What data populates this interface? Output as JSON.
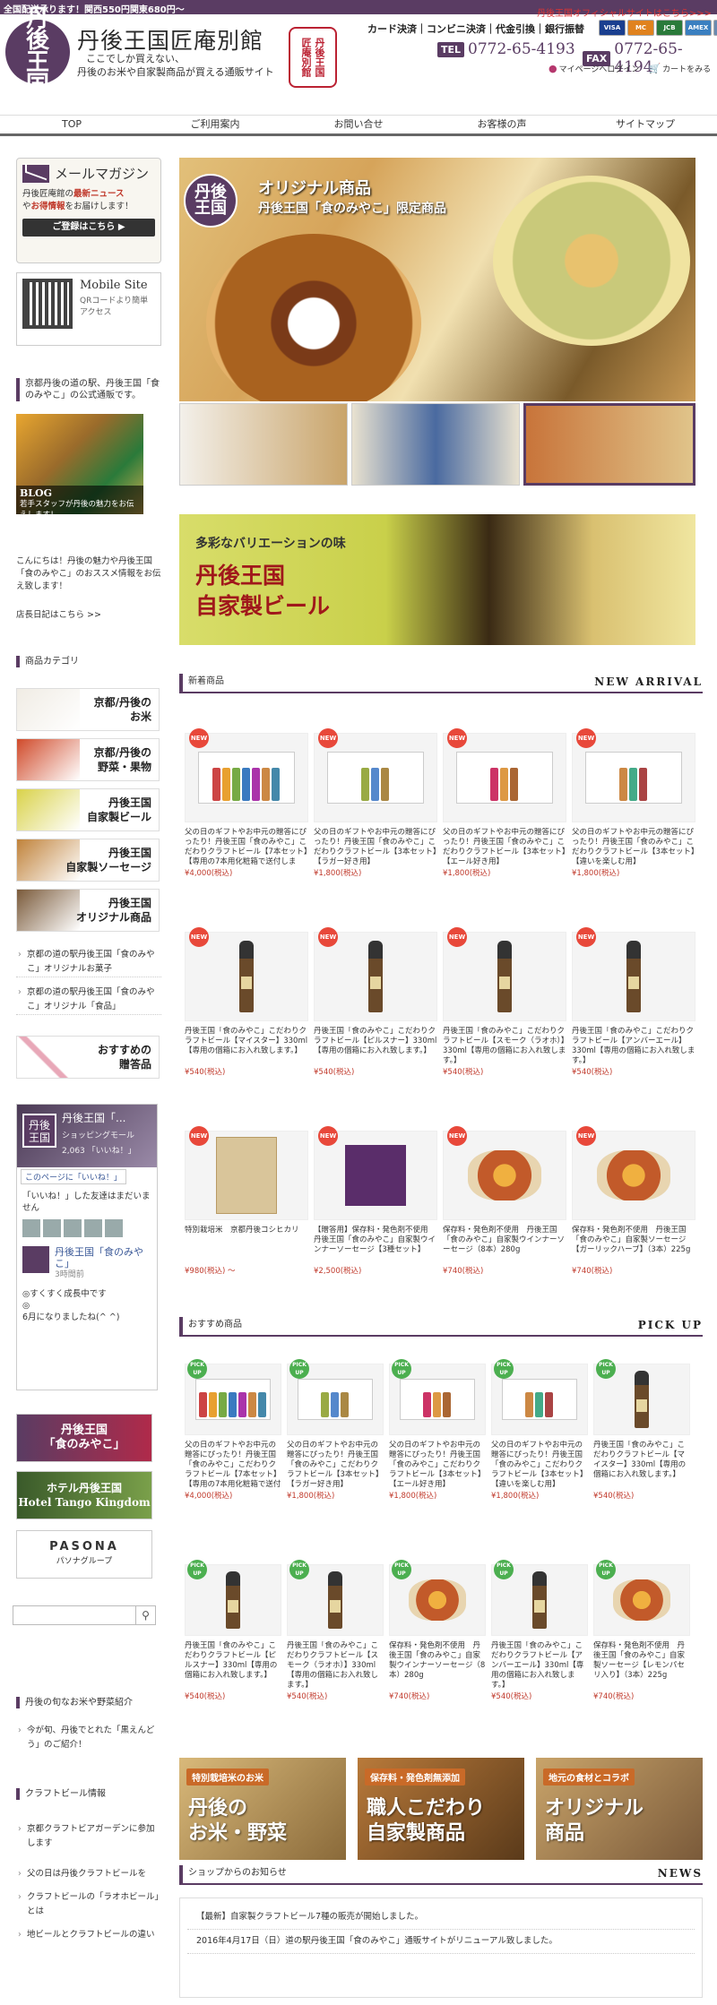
{
  "topbar": {
    "text": "全国配送承ります！関西550円関東680円〜"
  },
  "header": {
    "logo_text": "丹後王国",
    "site_name": "丹後王国匠庵別館",
    "tagline_1": "ここでしか買えない、",
    "tagline_2": "丹後のお米や自家製商品が買える通販サイト",
    "seal_col_1": "匠庵別館",
    "seal_col_2": "丹後王国",
    "official_link": "丹後王国オフィシャルサイトはこちら>>>",
    "payment_methods": "カード決済｜コンビニ決済｜代金引換｜銀行振替",
    "cards": [
      {
        "label": "VISA",
        "color": "#1a3f8f"
      },
      {
        "label": "MC",
        "color": "#e0821e"
      },
      {
        "label": "JCB",
        "color": "#2a7a3a"
      },
      {
        "label": "AMEX",
        "color": "#3a7fc0"
      },
      {
        "label": "DC",
        "color": "#6a8ab0"
      }
    ],
    "tel_label": "TEL",
    "tel_number": "0772-65-4193",
    "fax_label": "FAX",
    "fax_number": "0772-65-4194",
    "mypage": "マイページへログイン",
    "cart": "カートをみる"
  },
  "nav": [
    "TOP",
    "ご利用案内",
    "お問い合せ",
    "お客様の声",
    "サイトマップ"
  ],
  "sidebar": {
    "mail_title": "メールマガジン",
    "mail_desc_1": "丹後匠庵館の",
    "mail_desc_hl1": "最新ニュース",
    "mail_desc_2": "や",
    "mail_desc_hl2": "お得情報",
    "mail_desc_3": "をお届けします！",
    "mail_button": "ご登録はこちら ▶",
    "mobile_title": "Mobile Site",
    "mobile_desc": "QRコードより簡単アクセス",
    "blog_heading": "京都丹後の道の駅、丹後王国「食のみやこ」の公式通販です。",
    "blog_caption_title": "BLOG",
    "blog_caption": "若手スタッフが丹後の魅力をお伝えします！",
    "intro": "こんにちは！丹後の魅力や丹後王国「食のみやこ」のおススメ情報をお伝え致します！",
    "manager_link": "店長日記はこちら >>",
    "category_heading": "商品カテゴリ",
    "categories": [
      {
        "label": "京都/丹後の\nお米"
      },
      {
        "label": "京都/丹後の\n野菜・果物"
      },
      {
        "label": "丹後王国\n自家製ビール"
      },
      {
        "label": "丹後王国\n自家製ソーセージ"
      },
      {
        "label": "丹後王国\nオリジナル商品"
      }
    ],
    "cat_links": [
      "京都の道の駅丹後王国「食のみやこ」オリジナルお菓子",
      "京都の道の駅丹後王国「食のみやこ」オリジナル「食品」"
    ],
    "gift": "おすすめの\n贈答品",
    "fb_name": "丹後王国「...",
    "fb_sub": "ショッピングモール",
    "fb_likes": "2,063 「いいね！」",
    "fb_like_button": "このページに「いいね！」",
    "fb_friends": "「いいね！」した友達はまだいません",
    "fb_post_name": "丹後王国「食のみやこ」",
    "fb_post_time": "3時間前",
    "fb_post_1": "◎すくすく成長中です",
    "fb_post_2": "◎",
    "fb_post_3": "6月になりましたね(^ ^)",
    "banner_1": "丹後王国\n「食のみやこ」",
    "banner_2": "ホテル丹後王国\nHotel Tango Kingdom",
    "banner_3_main": "PASONA",
    "banner_3_sub": "パソナグループ",
    "info_heading": "丹後の旬なお米や野菜紹介",
    "info_link": "今が旬、丹後でとれた「黒えんどう」のご紹介！",
    "craft_heading": "クラフトビール情報",
    "craft_links": [
      "京都クラフトビアガーデンに参加します",
      "父の日は丹後クラフトビールを",
      "クラフトビールの「ラオホビール」とは",
      "地ビールとクラフトビールの違い"
    ]
  },
  "hero": {
    "badge": "丹後\n王国",
    "title_1": "オリジナル商品",
    "title_2": "丹後王国「食のみやこ」限定商品"
  },
  "beer_banner": {
    "line_1": "多彩なバリエーションの味",
    "line_2": "丹後王国",
    "line_3": "自家製ビール"
  },
  "new_arrival": {
    "heading": "新着商品",
    "heading_en": "NEW ARRIVAL",
    "badge": "NEW",
    "items": [
      {
        "name": "父の日のギフトやお中元の贈答にぴったり！丹後王国「食のみやこ」こだわりクラフトビール【7本セット】【専用の7本用化粧箱で送付します。】",
        "price": "¥4,000(税込)",
        "kind": "box7"
      },
      {
        "name": "父の日のギフトやお中元の贈答にぴったり！丹後王国「食のみやこ」こだわりクラフトビール【3本セット】【ラガー好き用】",
        "price": "¥1,800(税込)",
        "kind": "box3a"
      },
      {
        "name": "父の日のギフトやお中元の贈答にぴったり！丹後王国「食のみやこ」こだわりクラフトビール【3本セット】【エール好き用】",
        "price": "¥1,800(税込)",
        "kind": "box3b"
      },
      {
        "name": "父の日のギフトやお中元の贈答にぴったり！丹後王国「食のみやこ」こだわりクラフトビール【3本セット】【違いを楽しむ用】",
        "price": "¥1,800(税込)",
        "kind": "box3c"
      },
      {
        "name": "丹後王国「食のみやこ」こだわりクラフトビール【マイスター】330ml【専用の個箱にお入れ致します。】",
        "price": "¥540(税込)",
        "kind": "bottle"
      },
      {
        "name": "丹後王国「食のみやこ」こだわりクラフトビール【ピルスナー】330ml【専用の個箱にお入れ致します。】",
        "price": "¥540(税込)",
        "kind": "bottle"
      },
      {
        "name": "丹後王国「食のみやこ」こだわりクラフトビール【スモーク（ラオホ）】330ml【専用の個箱にお入れ致します。】",
        "price": "¥540(税込)",
        "kind": "bottle"
      },
      {
        "name": "丹後王国「食のみやこ」こだわりクラフトビール【アンバーエール】330ml【専用の個箱にお入れ致します。】",
        "price": "¥540(税込)",
        "kind": "bottle"
      },
      {
        "name": "特別栽培米　京都丹後コシヒカリ",
        "price": "¥980(税込) 〜",
        "kind": "bag"
      },
      {
        "name": "【贈答用】保存料・発色剤不使用　丹後王国「食のみやこ」自家製ウインナーソーセージ【3種セット】",
        "price": "¥2,500(税込)",
        "kind": "book"
      },
      {
        "name": "保存料・発色剤不使用　丹後王国「食のみやこ」自家製ウインナーソーセージ（8本）280g",
        "price": "¥740(税込)",
        "kind": "saus"
      },
      {
        "name": "保存料・発色剤不使用　丹後王国「食のみやこ」自家製ソーセージ【ガーリックハーブ】（3本）225g",
        "price": "¥740(税込)",
        "kind": "saus"
      }
    ]
  },
  "pick_up": {
    "heading": "おすすめ商品",
    "heading_en": "PICK UP",
    "badge": "PICK UP",
    "items": [
      {
        "name": "父の日のギフトやお中元の贈答にぴったり！丹後王国「食のみやこ」こだわりクラフトビール【7本セット】【専用の7本用化粧箱で送付します。】",
        "price": "¥4,000(税込)",
        "kind": "box7"
      },
      {
        "name": "父の日のギフトやお中元の贈答にぴったり！丹後王国「食のみやこ」こだわりクラフトビール【3本セット】【ラガー好き用】",
        "price": "¥1,800(税込)",
        "kind": "box3a"
      },
      {
        "name": "父の日のギフトやお中元の贈答にぴったり！丹後王国「食のみやこ」こだわりクラフトビール【3本セット】【エール好き用】",
        "price": "¥1,800(税込)",
        "kind": "box3b"
      },
      {
        "name": "父の日のギフトやお中元の贈答にぴったり！丹後王国「食のみやこ」こだわりクラフトビール【3本セット】【違いを楽しむ用】",
        "price": "¥1,800(税込)",
        "kind": "box3c"
      },
      {
        "name": "丹後王国「食のみやこ」こだわりクラフトビール【マイスター】330ml【専用の個箱にお入れ致します。】",
        "price": "¥540(税込)",
        "kind": "bottle"
      },
      {
        "name": "丹後王国「食のみやこ」こだわりクラフトビール【ピルスナー】330ml【専用の個箱にお入れ致します。】",
        "price": "¥540(税込)",
        "kind": "bottle"
      },
      {
        "name": "丹後王国「食のみやこ」こだわりクラフトビール【スモーク（ラオホ）】330ml【専用の個箱にお入れ致します。】",
        "price": "¥540(税込)",
        "kind": "bottle"
      },
      {
        "name": "保存料・発色剤不使用　丹後王国「食のみやこ」自家製ウインナーソーセージ（8本）280g",
        "price": "¥740(税込)",
        "kind": "saus"
      },
      {
        "name": "丹後王国「食のみやこ」こだわりクラフトビール【アンバーエール】330ml【専用の個箱にお入れ致します。】",
        "price": "¥540(税込)",
        "kind": "bottle"
      },
      {
        "name": "保存料・発色剤不使用　丹後王国「食のみやこ」自家製ソーセージ【レモンパセリ入り】（3本）225g",
        "price": "¥740(税込)",
        "kind": "saus"
      }
    ]
  },
  "bottom_banners": [
    {
      "small": "特別栽培米のお米",
      "large": "丹後の\nお米・野菜",
      "bg": "linear-gradient(135deg,#d9b97a,#8a6a3a)"
    },
    {
      "small": "保存料・発色剤無添加",
      "large": "職人こだわり\n自家製商品",
      "bg": "linear-gradient(135deg,#b97a3a,#5a3a1a)"
    },
    {
      "small": "地元の食材とコラボ",
      "large": "オリジナル\n商品",
      "bg": "linear-gradient(135deg,#c9a46a,#7a5a3a)"
    }
  ],
  "news": {
    "heading": "ショップからのお知らせ",
    "heading_en": "NEWS",
    "items": [
      "【最新】自家製クラフトビール7種の販売が開始しました。",
      "2016年4月17日（日）道の駅丹後王国「食のみやこ」通販サイトがリニューアル致しました。"
    ]
  }
}
